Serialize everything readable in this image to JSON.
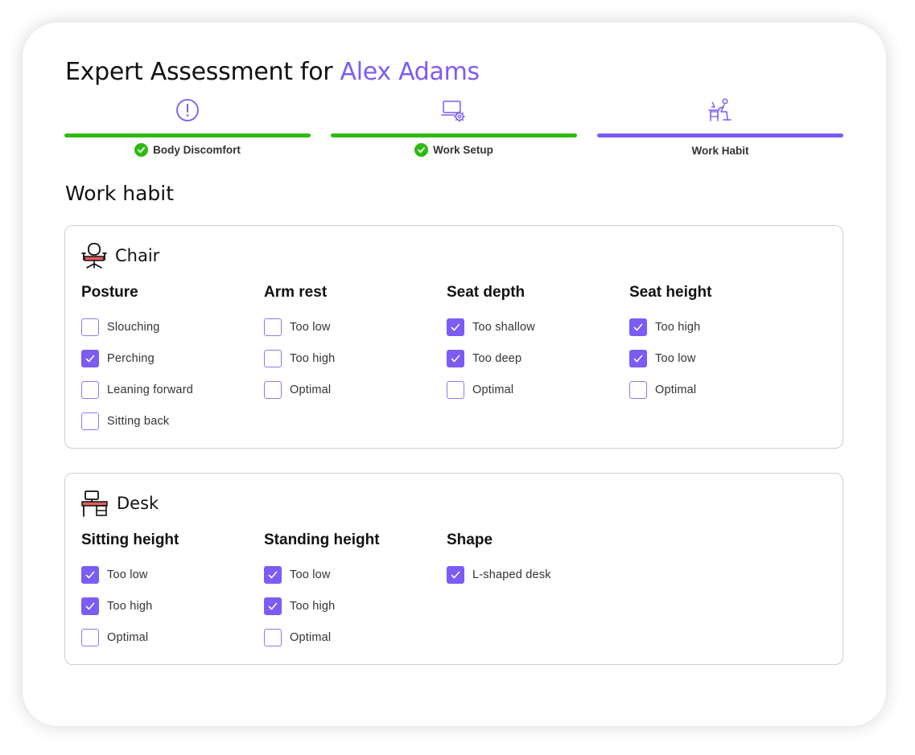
{
  "page": {
    "title_prefix": "Expert Assessment for ",
    "title_name": "Alex Adams",
    "accent_color": "#7b5cf5",
    "complete_color": "#2fba10"
  },
  "steps": [
    {
      "label": "Body Discomfort",
      "status": "complete",
      "icon": "alert-circle-icon"
    },
    {
      "label": "Work Setup",
      "status": "complete",
      "icon": "laptop-settings-icon"
    },
    {
      "label": "Work Habit",
      "status": "active",
      "icon": "person-at-desk-icon"
    }
  ],
  "section": {
    "title": "Work habit"
  },
  "chair": {
    "title": "Chair",
    "icon": "office-chair-icon",
    "groups": [
      {
        "title": "Posture",
        "options": [
          {
            "label": "Slouching",
            "checked": false
          },
          {
            "label": "Perching",
            "checked": true
          },
          {
            "label": "Leaning forward",
            "checked": false
          },
          {
            "label": "Sitting back",
            "checked": false
          }
        ]
      },
      {
        "title": "Arm rest",
        "options": [
          {
            "label": "Too low",
            "checked": false
          },
          {
            "label": "Too high",
            "checked": false
          },
          {
            "label": "Optimal",
            "checked": false
          }
        ]
      },
      {
        "title": "Seat depth",
        "options": [
          {
            "label": "Too shallow",
            "checked": true
          },
          {
            "label": "Too deep",
            "checked": true
          },
          {
            "label": "Optimal",
            "checked": false
          }
        ]
      },
      {
        "title": "Seat height",
        "options": [
          {
            "label": "Too high",
            "checked": true
          },
          {
            "label": "Too low",
            "checked": true
          },
          {
            "label": "Optimal",
            "checked": false
          }
        ]
      }
    ]
  },
  "desk": {
    "title": "Desk",
    "icon": "desk-icon",
    "groups": [
      {
        "title": "Sitting height",
        "options": [
          {
            "label": "Too low",
            "checked": true
          },
          {
            "label": "Too high",
            "checked": true
          },
          {
            "label": "Optimal",
            "checked": false
          }
        ]
      },
      {
        "title": "Standing height",
        "options": [
          {
            "label": "Too low",
            "checked": true
          },
          {
            "label": "Too high",
            "checked": true
          },
          {
            "label": "Optimal",
            "checked": false
          }
        ]
      },
      {
        "title": "Shape",
        "options": [
          {
            "label": "L-shaped desk",
            "checked": true
          }
        ]
      }
    ]
  }
}
